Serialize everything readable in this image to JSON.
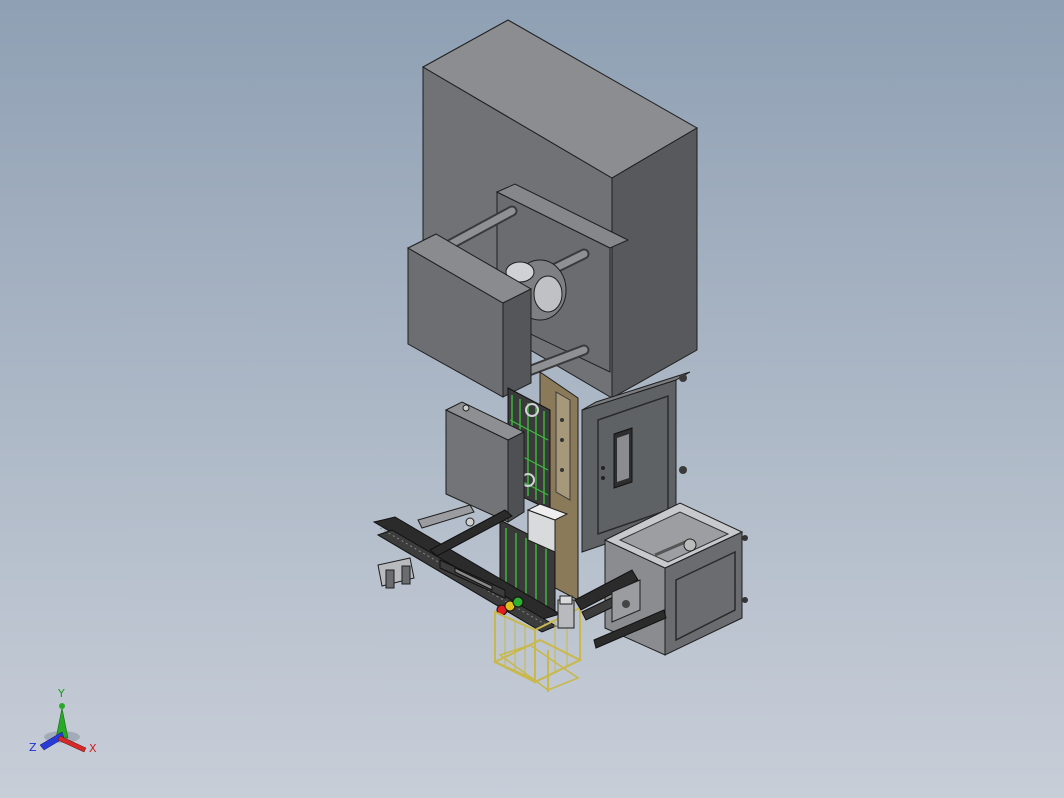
{
  "viewport": {
    "background_top": "#8fa0b4",
    "background_bottom": "#c8ced8"
  },
  "triad": {
    "y_label": "Y",
    "z_label": "Z",
    "x_label": "X",
    "y_color": "#1a9a1a",
    "z_color": "#1c2fd6",
    "x_color": "#d31a1a"
  },
  "model": {
    "body_color": "#6e7073",
    "side_color": "#55575a",
    "top_color": "#8a8c8f",
    "cabinet_color": "#5e6164",
    "frame_color": "#2b2b2b",
    "cable_color": "#3dbb3d",
    "wood_color": "#8b7a5a",
    "cart_color": "#c9b84a"
  }
}
